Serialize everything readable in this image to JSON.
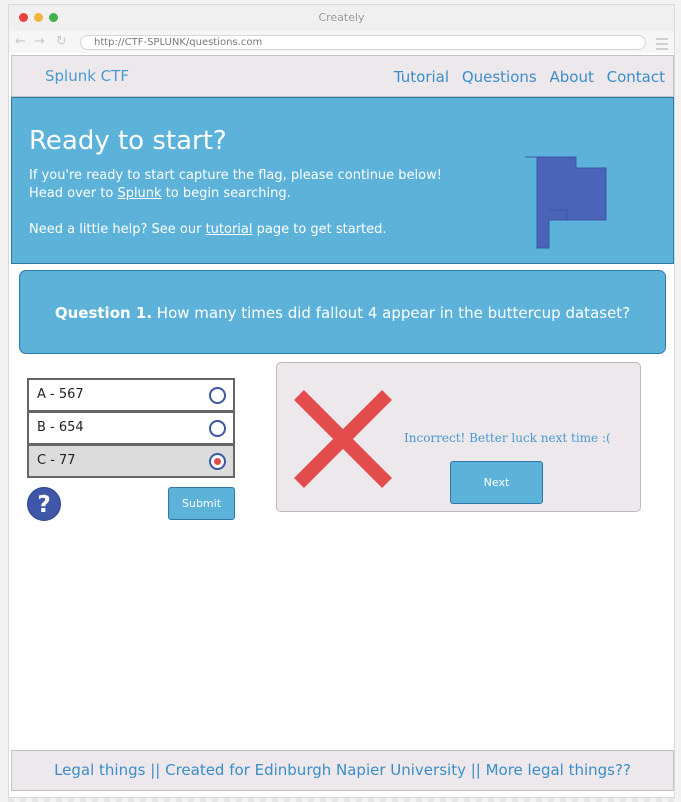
{
  "browser": {
    "window_title": "Creately",
    "url": "http://CTF-SPLUNK/questions.com"
  },
  "header": {
    "brand": "Splunk CTF",
    "nav": [
      "Tutorial",
      "Questions",
      "About",
      "Contact"
    ]
  },
  "hero": {
    "title": "Ready to start?",
    "line1": "If you're ready to start capture the flag, please continue below!",
    "line2_pre": "Head over to ",
    "line2_link": "Splunk",
    "line2_post": " to begin searching.",
    "line3_pre": "Need a little help? See our ",
    "line3_link": "tutorial",
    "line3_post": " page to get started.",
    "icon": "flag-icon"
  },
  "question": {
    "label": "Question 1.",
    "text": " How many times did fallout 4 appear in the buttercup dataset?"
  },
  "answers": [
    {
      "label": "A - 567",
      "selected": false
    },
    {
      "label": "B - 654",
      "selected": false
    },
    {
      "label": "C - 77",
      "selected": true
    }
  ],
  "controls": {
    "help_symbol": "?",
    "submit_label": "Submit"
  },
  "result": {
    "icon": "x-icon",
    "message": "Incorrect! Better luck next time :(",
    "next_label": "Next"
  },
  "footer": {
    "text": "Legal things || Created for Edinburgh Napier University || More legal things??"
  },
  "colors": {
    "primary": "#5cb2d9",
    "accent_dark": "#3f57a8",
    "error": "#e34c4c",
    "panel": "#ece8ec"
  }
}
